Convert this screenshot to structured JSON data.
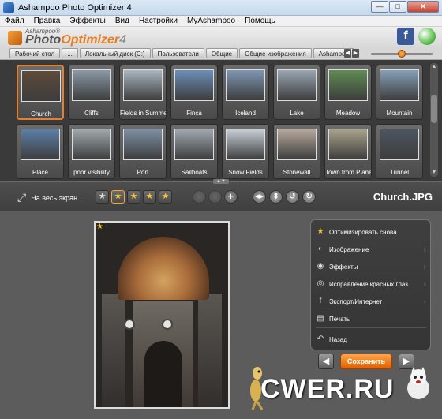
{
  "window": {
    "title": "Ashampoo Photo Optimizer 4"
  },
  "menu": [
    "Файл",
    "Правка",
    "Эффекты",
    "Вид",
    "Настройки",
    "MyAshampoo",
    "Помощь"
  ],
  "logo": {
    "small": "Ashampoo®",
    "name_part1": "Photo",
    "name_part2": "Optimizer",
    "version": "4"
  },
  "path": [
    "Рабочий стол",
    "...",
    "Локальный диск (C:)",
    "Пользователи",
    "Общие",
    "Общие изображения",
    "Ashampoo"
  ],
  "gallery": {
    "thumbnails": [
      {
        "label": "Church",
        "selected": true,
        "color": "#5e4a3a"
      },
      {
        "label": "Cliffs",
        "selected": false,
        "color": "#8b99a6"
      },
      {
        "label": "Fields in Summe",
        "selected": false,
        "color": "#a9b7c0"
      },
      {
        "label": "Finca",
        "selected": false,
        "color": "#6b8fb8"
      },
      {
        "label": "Iceland",
        "selected": false,
        "color": "#7e96b2"
      },
      {
        "label": "Lake",
        "selected": false,
        "color": "#9aa6b3"
      },
      {
        "label": "Meadow",
        "selected": false,
        "color": "#5f8c52"
      },
      {
        "label": "Mountain",
        "selected": false,
        "color": "#86a0b8"
      },
      {
        "label": "Place",
        "selected": false,
        "color": "#5c7ea6"
      },
      {
        "label": "poor visibility",
        "selected": false,
        "color": "#a0a8ad"
      },
      {
        "label": "Port",
        "selected": false,
        "color": "#7c8fa3"
      },
      {
        "label": "Sailboats",
        "selected": false,
        "color": "#9fa8b0"
      },
      {
        "label": "Snow Fields",
        "selected": false,
        "color": "#c7cfd6"
      },
      {
        "label": "Stonewall",
        "selected": false,
        "color": "#b6a89a"
      },
      {
        "label": "Town from Plane",
        "selected": false,
        "color": "#a8a28a"
      },
      {
        "label": "Tunnel",
        "selected": false,
        "color": "#4c5560"
      }
    ]
  },
  "toolbar": {
    "fullscreen_label": "На весь экран",
    "filename": "Church.JPG",
    "rating_stars": 1
  },
  "panel": {
    "items": [
      {
        "label": "Оптимизировать снова",
        "icon": "star-icon",
        "has_chevron": false
      },
      {
        "label": "Изображение",
        "icon": "image-icon",
        "has_chevron": true
      },
      {
        "label": "Эффекты",
        "icon": "effects-icon",
        "has_chevron": true
      },
      {
        "label": "Исправление красных глаз",
        "icon": "eye-icon",
        "has_chevron": true
      },
      {
        "label": "Экспорт/Интернет",
        "icon": "facebook-icon",
        "has_chevron": true
      },
      {
        "label": "Печать",
        "icon": "printer-icon",
        "has_chevron": false
      },
      {
        "label": "Назад",
        "icon": "undo-icon",
        "has_chevron": false
      }
    ]
  },
  "save_button": "Сохранить",
  "watermark": "CWER.RU",
  "colors": {
    "accent": "#e8802a",
    "save": "#f07a14"
  }
}
